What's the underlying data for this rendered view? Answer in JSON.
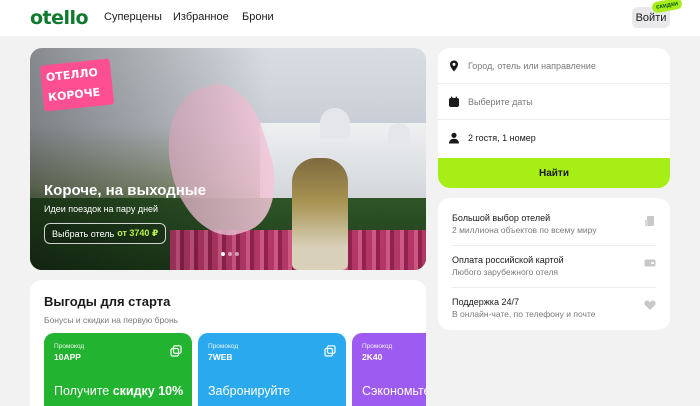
{
  "header": {
    "logo": "otello",
    "nav": [
      "Суперцены",
      "Избранное",
      "Брони"
    ],
    "login_label": "Войти",
    "login_badge": "скидки"
  },
  "hero": {
    "sticker_line1": "ОТЕЛЛО",
    "sticker_line2": "КОРОЧЕ",
    "title": "Короче, на выходные",
    "subtitle": "Идеи поездок на пару дней",
    "button_text": "Выбрать отель",
    "button_price": "от 3740 ₽",
    "slides": 3,
    "active_slide": 1
  },
  "search": {
    "destination_placeholder": "Город, отель или направление",
    "dates_placeholder": "Выберите даты",
    "guests_value": "2 гостя, 1 номер",
    "submit_label": "Найти"
  },
  "features": [
    {
      "title": "Большой выбор отелей",
      "subtitle": "2 миллиона объектов по всему миру",
      "icon": "building-icon"
    },
    {
      "title": "Оплата российской картой",
      "subtitle": "Любого зарубежного отеля",
      "icon": "card-icon"
    },
    {
      "title": "Поддержка 24/7",
      "subtitle": "В онлайн-чате, по телефону и почте",
      "icon": "heart-icon"
    }
  ],
  "benefits": {
    "title": "Выгоды для старта",
    "subtitle": "Бонусы и скидки на первую бронь",
    "promos": [
      {
        "label": "Промокод",
        "code": "10APP",
        "text_pre": "Получите ",
        "text_bold": "скидку 10%",
        "color": "#22b330"
      },
      {
        "label": "Промокод",
        "code": "7WEB",
        "text_pre": "Забронируйте",
        "text_bold": "",
        "color": "#2aa9ee"
      },
      {
        "label": "Промокод",
        "code": "2K40",
        "text_pre": "Сэкономьте",
        "text_bold": "",
        "color": "#9d5bf2"
      }
    ]
  },
  "colors": {
    "brand_green": "#0f7a2e",
    "accent_lime": "#a6ee16",
    "hero_pink": "#ff4f93"
  }
}
